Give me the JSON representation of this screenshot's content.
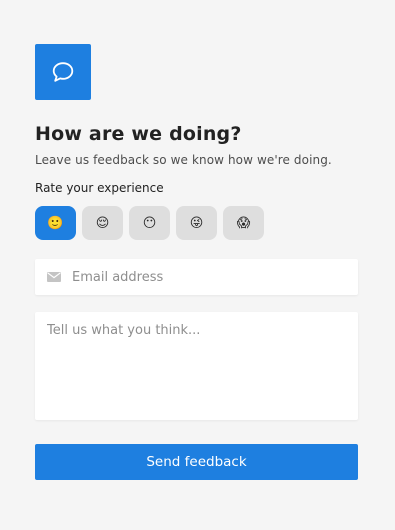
{
  "header": {
    "logo_icon": "chat-bubble-icon",
    "title": "How are we doing?",
    "subtitle": "Leave us feedback so we know how we're doing."
  },
  "rating": {
    "label": "Rate your experience",
    "selected_index": 0,
    "options": [
      {
        "emoji": "🙂",
        "icon": "slightly-smiling-face-icon"
      },
      {
        "emoji": "😌",
        "icon": "relieved-face-icon"
      },
      {
        "emoji": "😶",
        "icon": "neutral-face-icon"
      },
      {
        "emoji": "😜",
        "icon": "winking-tongue-face-icon"
      },
      {
        "emoji": "😱",
        "icon": "screaming-face-icon"
      }
    ]
  },
  "email": {
    "icon": "envelope-icon",
    "placeholder": "Email address",
    "value": ""
  },
  "message": {
    "placeholder": "Tell us what you think...",
    "value": ""
  },
  "submit": {
    "label": "Send feedback"
  },
  "colors": {
    "accent": "#1e7fe0",
    "background": "#f5f5f5",
    "rating_inactive": "#dedede"
  }
}
